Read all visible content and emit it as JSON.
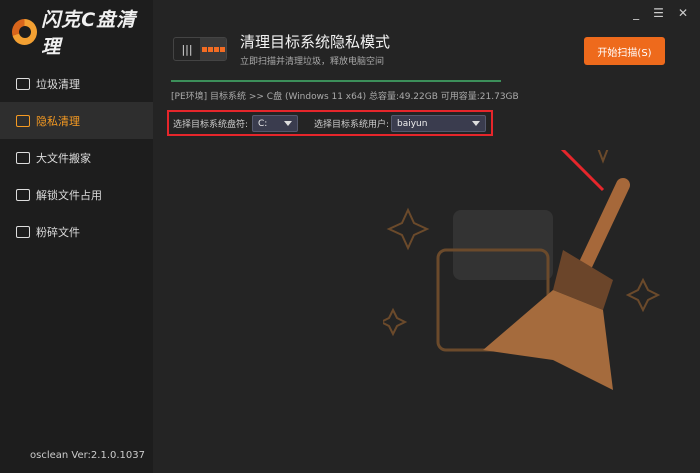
{
  "app": {
    "logo_text": "闪克C盘清理",
    "version": "osclean Ver:2.1.0.1037"
  },
  "sidebar": {
    "items": [
      {
        "label": "垃圾清理",
        "icon": "trash-icon"
      },
      {
        "label": "隐私清理",
        "icon": "monitor-icon",
        "active": true
      },
      {
        "label": "大文件搬家",
        "icon": "file-move-icon"
      },
      {
        "label": "解锁文件占用",
        "icon": "file-unlock-icon"
      },
      {
        "label": "粉碎文件",
        "icon": "shred-icon"
      }
    ]
  },
  "window": {
    "minimize": "_",
    "menu": "☰",
    "close": "✕"
  },
  "header": {
    "title": "清理目标系统隐私模式",
    "subtitle": "立即扫描并清理垃圾，释放电脑空间",
    "start_button": "开始扫描(S)"
  },
  "system_info": "[PE环境] 目标系统 >> C盘 (Windows 11 x64) 总容量:49.22GB 可用容量:21.73GB",
  "selectors": {
    "drive_label": "选择目标系统盘符:",
    "drive_value": "C:",
    "user_label": "选择目标系统用户:",
    "user_value": "baiyun"
  },
  "colors": {
    "accent": "#ee6a1c",
    "active_text": "#f59a22",
    "highlight_border": "#e6262b"
  }
}
